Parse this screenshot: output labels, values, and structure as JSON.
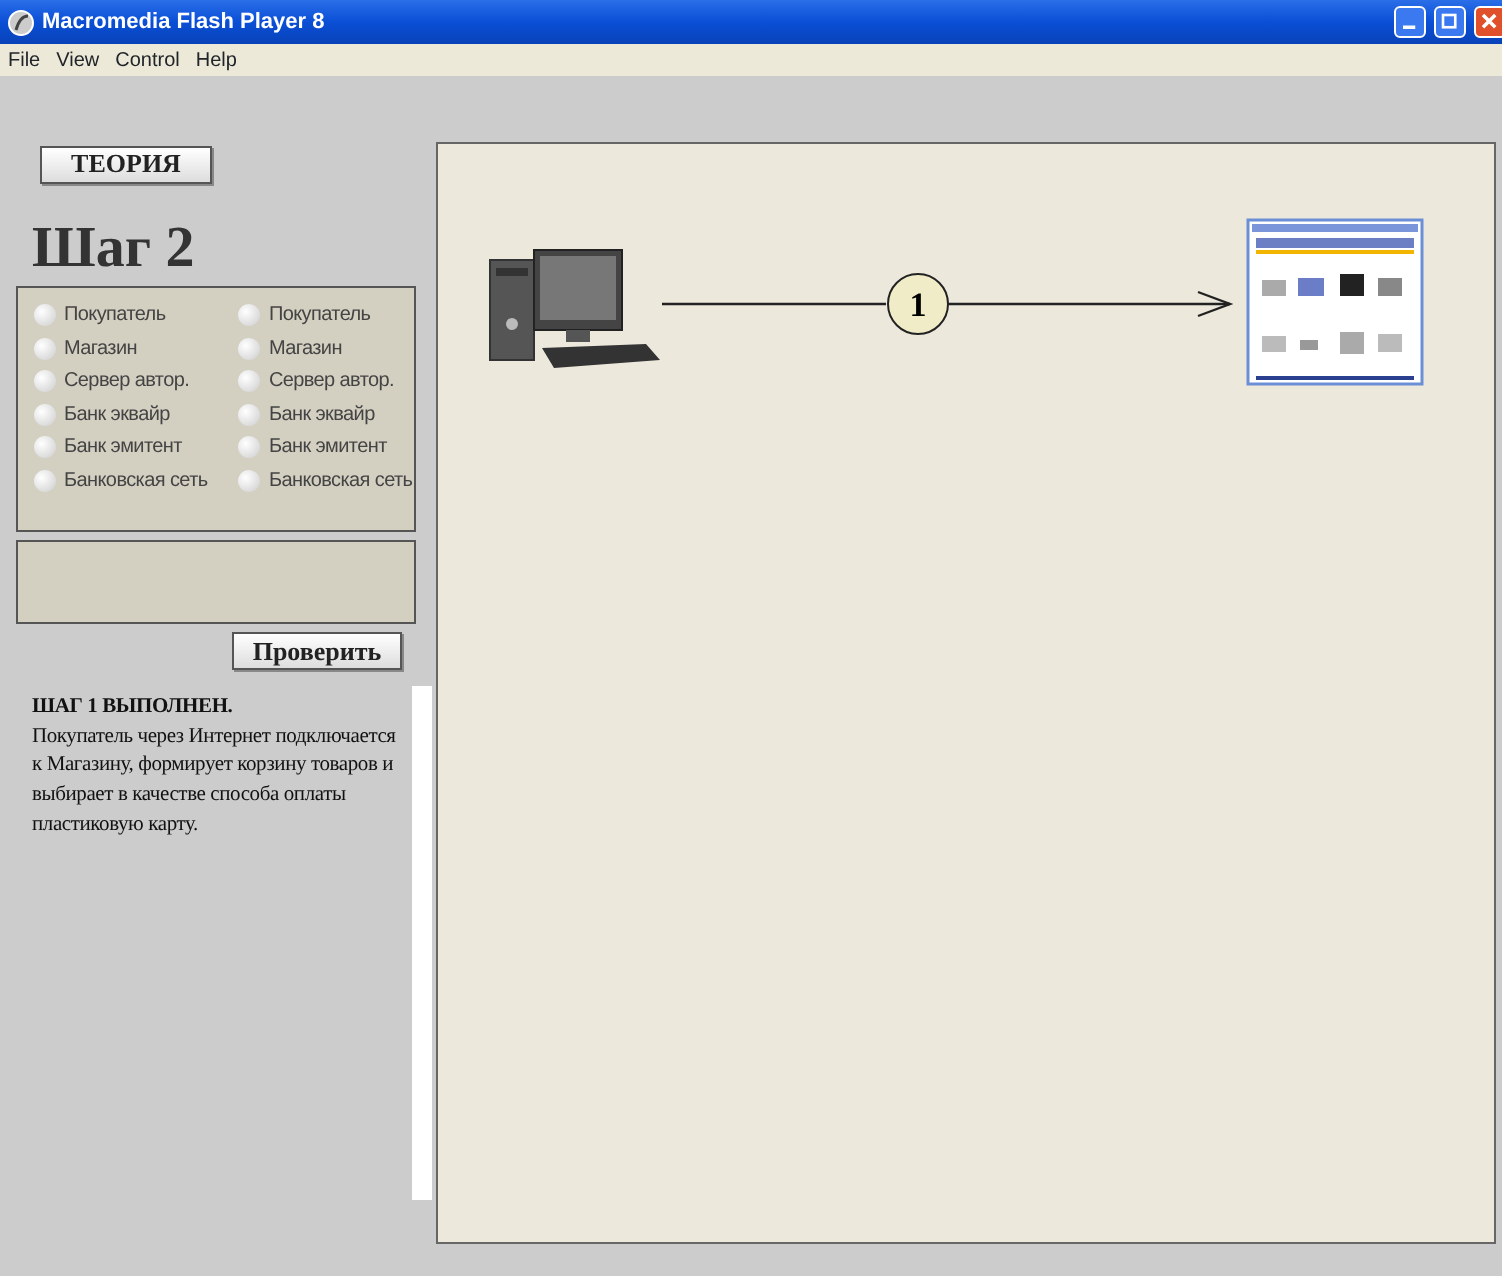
{
  "window": {
    "title": "Macromedia Flash Player 8"
  },
  "menu": [
    "File",
    "View",
    "Control",
    "Help"
  ],
  "theory_button": "ТЕОРИЯ",
  "step_title": "Шаг 2",
  "radio_columns": [
    [
      {
        "label": "Покупатель",
        "selected": false
      },
      {
        "label": "Магазин",
        "selected": false
      },
      {
        "label": "Сервер автор.",
        "selected": false
      },
      {
        "label": "Банк эквайр",
        "selected": false
      },
      {
        "label": "Банк эмитент",
        "selected": false
      },
      {
        "label": "Банковская сеть",
        "selected": false
      }
    ],
    [
      {
        "label": "Покупатель",
        "selected": false
      },
      {
        "label": "Магазин",
        "selected": false
      },
      {
        "label": "Сервер автор.",
        "selected": false
      },
      {
        "label": "Банк эквайр",
        "selected": false
      },
      {
        "label": "Банк эмитент",
        "selected": false
      },
      {
        "label": "Банковская сеть",
        "selected": false
      }
    ]
  ],
  "check_button": "Проверить",
  "message": {
    "heading": "ШАГ 1 ВЫПОЛНЕН.",
    "text": "Покупатель через Интернет подключается к Магазину, формирует корзину товаров и выбирает в качестве способа оплаты пластиковую карту."
  },
  "diagram": {
    "step_label": "1"
  }
}
